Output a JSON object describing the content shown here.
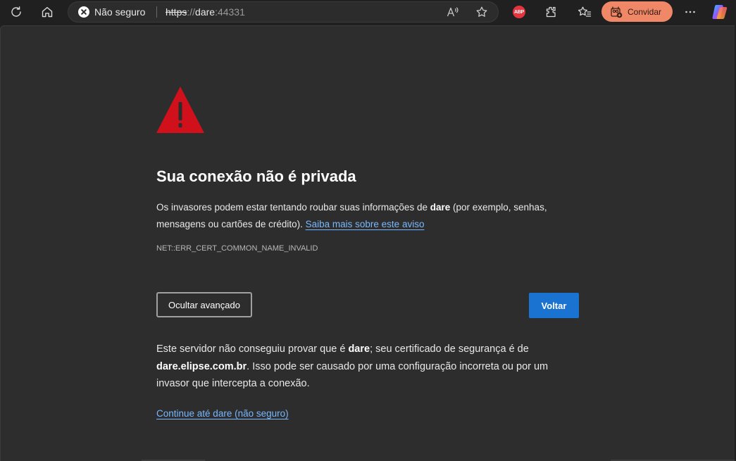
{
  "toolbar": {
    "security_label": "Não seguro",
    "url": {
      "scheme": "https",
      "separator": "://",
      "host": "dare",
      "port": ":44331"
    },
    "invite_label": "Convidar",
    "abp_badge": "ABP",
    "icons": [
      "refresh-icon",
      "home-icon",
      "read-aloud-icon",
      "favorite-star-icon",
      "adblock-plus-icon",
      "extensions-icon",
      "favorites-icon",
      "invite-icon",
      "more-menu-icon",
      "copilot-icon"
    ]
  },
  "page": {
    "title": "Sua conexão não é privada",
    "message": {
      "part1": "Os invasores podem estar tentando roubar suas informações de ",
      "host": "dare",
      "part2": " (por exemplo, senhas, mensagens ou cartões de crédito). ",
      "learn_more": "Saiba mais sobre este aviso"
    },
    "error_code": "NET::ERR_CERT_COMMON_NAME_INVALID",
    "hide_advanced_label": "Ocultar avançado",
    "back_label": "Voltar",
    "detail": {
      "part1": "Este servidor não conseguiu provar que é ",
      "host": "dare",
      "part2": "; seu certificado de segurança é de ",
      "cert_host": "dare.elipse.com.br",
      "part3": ". Isso pode ser causado por uma configuração incorreta ou por um invasor que intercepta a conexão."
    },
    "continue_label": "Continue até dare (não seguro)"
  },
  "colors": {
    "page_bg": "#2d2d2d",
    "warning_red": "#d0101b",
    "primary_button": "#1a73d1",
    "link": "#79b8ff",
    "invite_button": "#f08868"
  }
}
